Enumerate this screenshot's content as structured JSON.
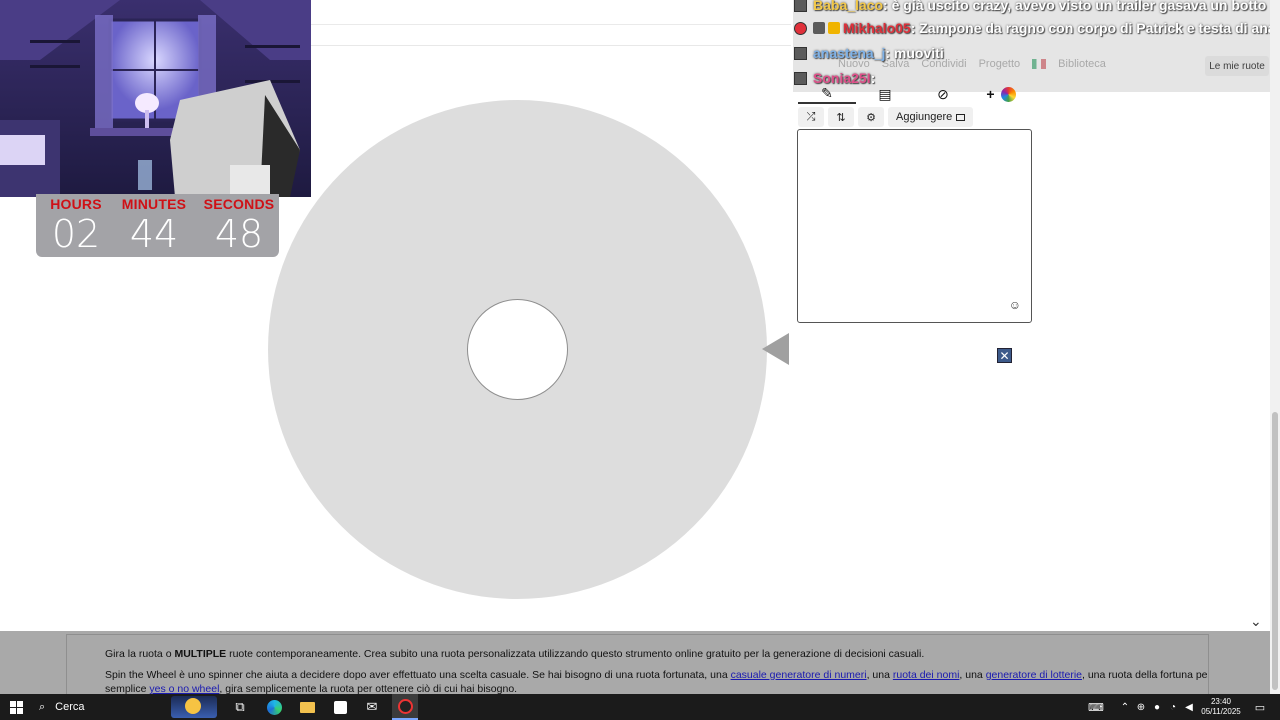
{
  "webcam": {
    "alt": "streamer webcam with purple bedroom"
  },
  "timer": {
    "hours_label": "HOURS",
    "hours": "02",
    "minutes_label": "MINUTES",
    "minutes": "44",
    "seconds_label": "SECONDS",
    "seconds": "48"
  },
  "chat": {
    "messages": [
      {
        "user": "Baba_laco",
        "user_color": "#f3c94a",
        "text": ": è già uscito crazy, avevo visto un trailer gasava un botto"
      },
      {
        "user": "Mikhalo05",
        "user_color": "#e0303a",
        "text": ": Zampone da ragno con corpo di Patrick e testa di ana 2.0"
      },
      {
        "user": "anastena_j",
        "user_color": "#7fb2e8",
        "text": ": muoviti"
      },
      {
        "user": "Sonia25I",
        "user_color": "#e0508a",
        "text": ":"
      }
    ]
  },
  "sitenav": {
    "items": [
      "Nuovo",
      "Salva",
      "Condividi",
      "Progetto",
      "Biblioteca"
    ],
    "my_wheels": "Le mie ruote"
  },
  "editor": {
    "tabs": [
      "pencil-icon",
      "clipboard-icon",
      "eye-slash-icon",
      "palette-icon"
    ],
    "add_symbol": "+",
    "tools": {
      "shuffle": "⤮",
      "sort": "⇅",
      "settings": "⚙",
      "add_image": "Aggiungere"
    },
    "entries_value": "",
    "emoji": "☺",
    "close": "✕"
  },
  "info": {
    "line1_pre": "Gira la ruota o ",
    "line1_bold": "MULTIPLE",
    "line1_post": " ruote contemporaneamente. Crea subito una ruota personalizzata utilizzando questo strumento online gratuito per la generazione di decisioni casuali.",
    "line2_pre": "Spin the Wheel è uno spinner che aiuta a decidere dopo aver effettuato una scelta casuale. Se hai bisogno di una ruota fortunata, una ",
    "link1": "casuale generatore di numeri",
    "mid1": ", una ",
    "link2": "ruota dei nomi",
    "mid2": ", una ",
    "link3": "generatore di lotterie",
    "line2_post": ", una ruota della fortuna per i giochi o un",
    "line3_pre": "semplice ",
    "link4": "yes o no wheel",
    "line3_post": ", gira semplicemente la ruota per ottenere ciò di cui hai bisogno."
  },
  "taskbar": {
    "search_placeholder": "Cerca",
    "time": "23:40",
    "date": "05/11/2025"
  },
  "colors": {
    "wheel": "#dddddd",
    "timer_label": "#cf1016",
    "timer_bg": "#a3a3a7",
    "info_bg": "#a9a9a9",
    "taskbar": "#1b1b1b"
  }
}
